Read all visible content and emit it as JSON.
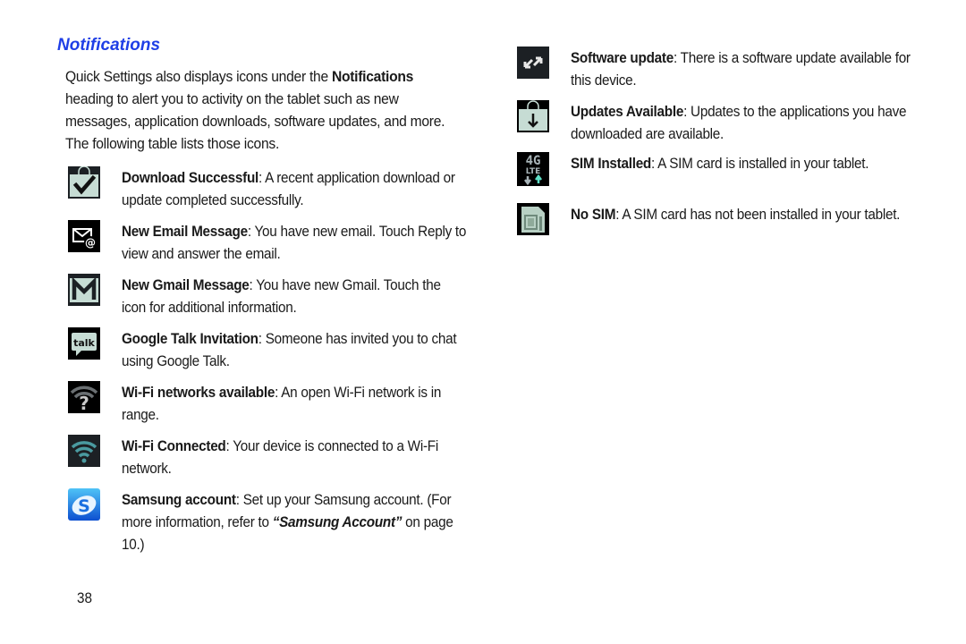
{
  "heading": "Notifications",
  "intro": {
    "before": "Quick Settings also displays icons under the ",
    "bold": "Notifications",
    "after": " heading to alert you to activity on the tablet such as new messages, application downloads, software updates, and more. The following table lists those icons."
  },
  "left_column": [
    {
      "icon": "download-successful-icon",
      "term": "Download Successful",
      "desc": ": A recent application download or update completed successfully."
    },
    {
      "icon": "new-email-icon",
      "term": "New Email Message",
      "desc": ": You have new email. Touch Reply to view and answer the email."
    },
    {
      "icon": "new-gmail-icon",
      "term": "New Gmail Message",
      "desc": ": You have new Gmail. Touch the icon for additional information."
    },
    {
      "icon": "google-talk-icon",
      "term": "Google Talk Invitation",
      "desc": ": Someone has invited you to chat using Google Talk."
    },
    {
      "icon": "wifi-available-icon",
      "term": "Wi-Fi networks available",
      "desc": ": An open Wi-Fi network is in range."
    },
    {
      "icon": "wifi-connected-icon",
      "term": "Wi-Fi Connected",
      "desc": ": Your device is connected to a Wi-Fi network."
    },
    {
      "icon": "samsung-account-icon",
      "term": "Samsung account",
      "desc": ": Set up your Samsung account. (For more information, refer to ",
      "ref": "“Samsung Account”",
      "after": " on page 10.)"
    }
  ],
  "right_column": [
    {
      "icon": "software-update-icon",
      "term": "Software update",
      "desc": ": There is a software update available for this device."
    },
    {
      "icon": "updates-available-icon",
      "term": "Updates Available",
      "desc": ": Updates to the applications you have downloaded are available."
    },
    {
      "icon": "sim-installed-icon",
      "term": "SIM Installed",
      "desc": ": A SIM card is installed in your tablet.",
      "icon_label_top": "4G",
      "icon_label_bottom": "LTE"
    },
    {
      "icon": "no-sim-icon",
      "term": "No SIM",
      "desc": ": A SIM card has not been installed in your tablet."
    }
  ],
  "icon_text": {
    "talk": "talk",
    "samsung": "S"
  },
  "page_number": "38",
  "colors": {
    "heading": "#1f3fe6",
    "icon_dark": "#1c2024",
    "icon_light": "#c6dcd4",
    "wifi_teal": "#4a9aa0",
    "samsung_blue": "#1a6fe0"
  }
}
